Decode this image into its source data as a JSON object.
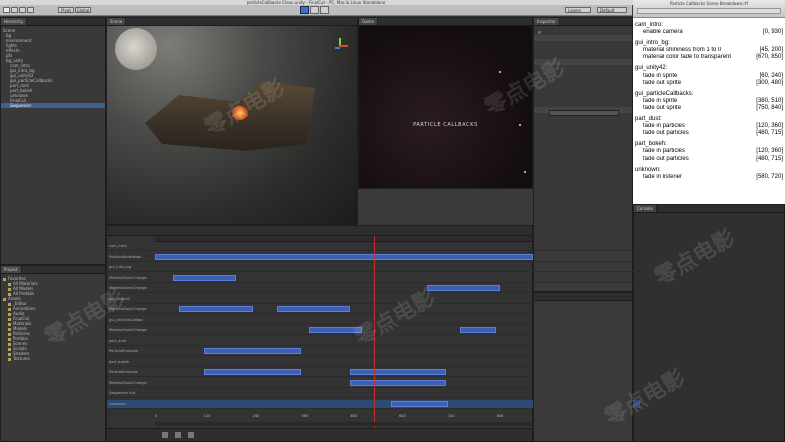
{
  "window_title": "particleCallbacks Clean.unity - FinalCut - PC, Mac & Linux Standalone",
  "doc_window_title": "Particle Callbacks Scene Breakdown.rtf",
  "toolbar": {
    "pivot": "Pivot",
    "global": "Global",
    "layers": "Layers",
    "layout": "Default"
  },
  "scene_tab": "Scene",
  "game_tab": "Game",
  "inspector_tab": "Inspector",
  "hierarchy_tab": "Hierarchy",
  "project_tab": "Project",
  "console_tab": "Console",
  "game_overlay_text": "PARTICLE CALLBACKS",
  "hierarchy_items": [
    "Scene",
    "bg",
    "environment",
    "lights",
    "effects",
    "pfx",
    "bg_unity",
    "cam_intro",
    "gui_intro_bg",
    "gui_unity42",
    "gui_particleCallbacks",
    "part_dust",
    "part_bokeh",
    "unknown",
    "FinalCut",
    "Sequencer"
  ],
  "project_items": [
    "Favorites",
    "All Materials",
    "All Models",
    "All Prefabs",
    "Assets",
    "_Editor",
    "Animations",
    "Audio",
    "FinalCut",
    "Materials",
    "Models",
    "Particles",
    "Prefabs",
    "Scenes",
    "Scripts",
    "Shaders",
    "Textures"
  ],
  "timeline_rows": [
    {
      "label": "cam_intro"
    },
    {
      "label": "  PositionAnimation"
    },
    {
      "label": "gui_intro_bg"
    },
    {
      "label": "  MaterialColorChange"
    },
    {
      "label": "  MaterialColorChange"
    },
    {
      "label": "gui_unity42"
    },
    {
      "label": "  MaterialColorChange"
    },
    {
      "label": "gui_particleCallbac"
    },
    {
      "label": "  MaterialColorChange"
    },
    {
      "label": "part_dust"
    },
    {
      "label": "  ParticleEmission"
    },
    {
      "label": "part_bokeh"
    },
    {
      "label": "  ParticleEmission"
    },
    {
      "label": "  MaterialColorChange"
    },
    {
      "label": "Sequencer Evt"
    },
    {
      "label": "Unknown"
    }
  ],
  "timeline_ticks": [
    "0",
    "120",
    "240",
    "360",
    "480",
    "600",
    "720",
    "840"
  ],
  "doc_sections": [
    {
      "name": "cam_intro:",
      "items": [
        {
          "text": "enable camera",
          "range": "[0, 930]"
        }
      ]
    },
    {
      "name": "gui_intro_bg:",
      "items": [
        {
          "text": "material shininess from 1 to 0",
          "range": "[45, 200]"
        },
        {
          "text": "material color fade to transparent",
          "range": "[670, 850]"
        }
      ]
    },
    {
      "name": "gui_unity42:",
      "items": [
        {
          "text": "fade in sprite",
          "range": "[60, 240]"
        },
        {
          "text": "fade out sprite",
          "range": "[300, 480]"
        }
      ]
    },
    {
      "name": "gui_particleCallbacks:",
      "items": [
        {
          "text": "fade in sprite",
          "range": "[380, 510]"
        },
        {
          "text": "fade out sprite",
          "range": "[750, 840]"
        }
      ]
    },
    {
      "name": "part_dust:",
      "items": [
        {
          "text": "fade in particles",
          "range": "[120, 360]"
        },
        {
          "text": "fade out particles",
          "range": "[480, 715]"
        }
      ]
    },
    {
      "name": "part_bokeh:",
      "items": [
        {
          "text": "fade in particles",
          "range": "[120, 360]"
        },
        {
          "text": "fade out particles",
          "range": "[480, 715]"
        }
      ]
    },
    {
      "name": "unknown:",
      "items": [
        {
          "text": "fade in listener",
          "range": "[580, 720]"
        }
      ]
    }
  ],
  "watermark": "零点电影"
}
